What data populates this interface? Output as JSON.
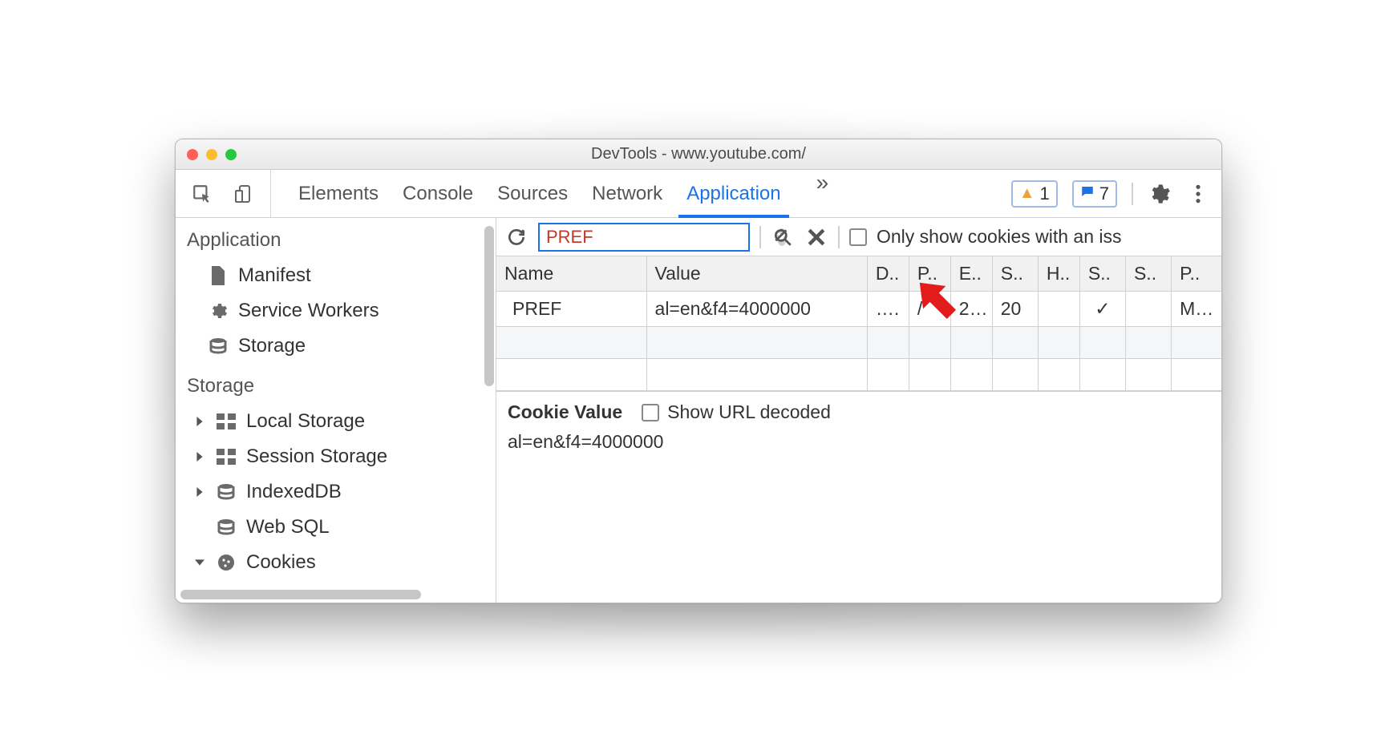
{
  "window": {
    "title": "DevTools - www.youtube.com/"
  },
  "toolbar": {
    "tabs": [
      "Elements",
      "Console",
      "Sources",
      "Network",
      "Application"
    ],
    "activeTabIndex": 4,
    "warnings_count": "1",
    "messages_count": "7"
  },
  "sidebar": {
    "sections": [
      {
        "title": "Application",
        "items": [
          {
            "label": "Manifest",
            "icon": "file-icon"
          },
          {
            "label": "Service Workers",
            "icon": "gear-icon"
          },
          {
            "label": "Storage",
            "icon": "database-icon"
          }
        ]
      },
      {
        "title": "Storage",
        "items": [
          {
            "label": "Local Storage",
            "icon": "grid-icon",
            "expandable": true
          },
          {
            "label": "Session Storage",
            "icon": "grid-icon",
            "expandable": true
          },
          {
            "label": "IndexedDB",
            "icon": "database-icon",
            "expandable": true
          },
          {
            "label": "Web SQL",
            "icon": "database-icon",
            "expandable": false
          },
          {
            "label": "Cookies",
            "icon": "cookie-icon",
            "expandable": true,
            "expanded": true
          }
        ]
      }
    ]
  },
  "filter": {
    "value": "PREF",
    "only_issues_label": "Only show cookies with an iss"
  },
  "table": {
    "headers": [
      "Name",
      "Value",
      "D..",
      "P..",
      "E..",
      "S..",
      "H..",
      "S..",
      "S..",
      "P.."
    ],
    "rows": [
      {
        "cells": [
          "PREF",
          "al=en&f4=4000000",
          "….",
          "/",
          "2…",
          "20",
          "",
          "✓",
          "",
          "M…"
        ]
      }
    ]
  },
  "detail": {
    "label": "Cookie Value",
    "show_decoded_label": "Show URL decoded",
    "value": "al=en&f4=4000000"
  }
}
